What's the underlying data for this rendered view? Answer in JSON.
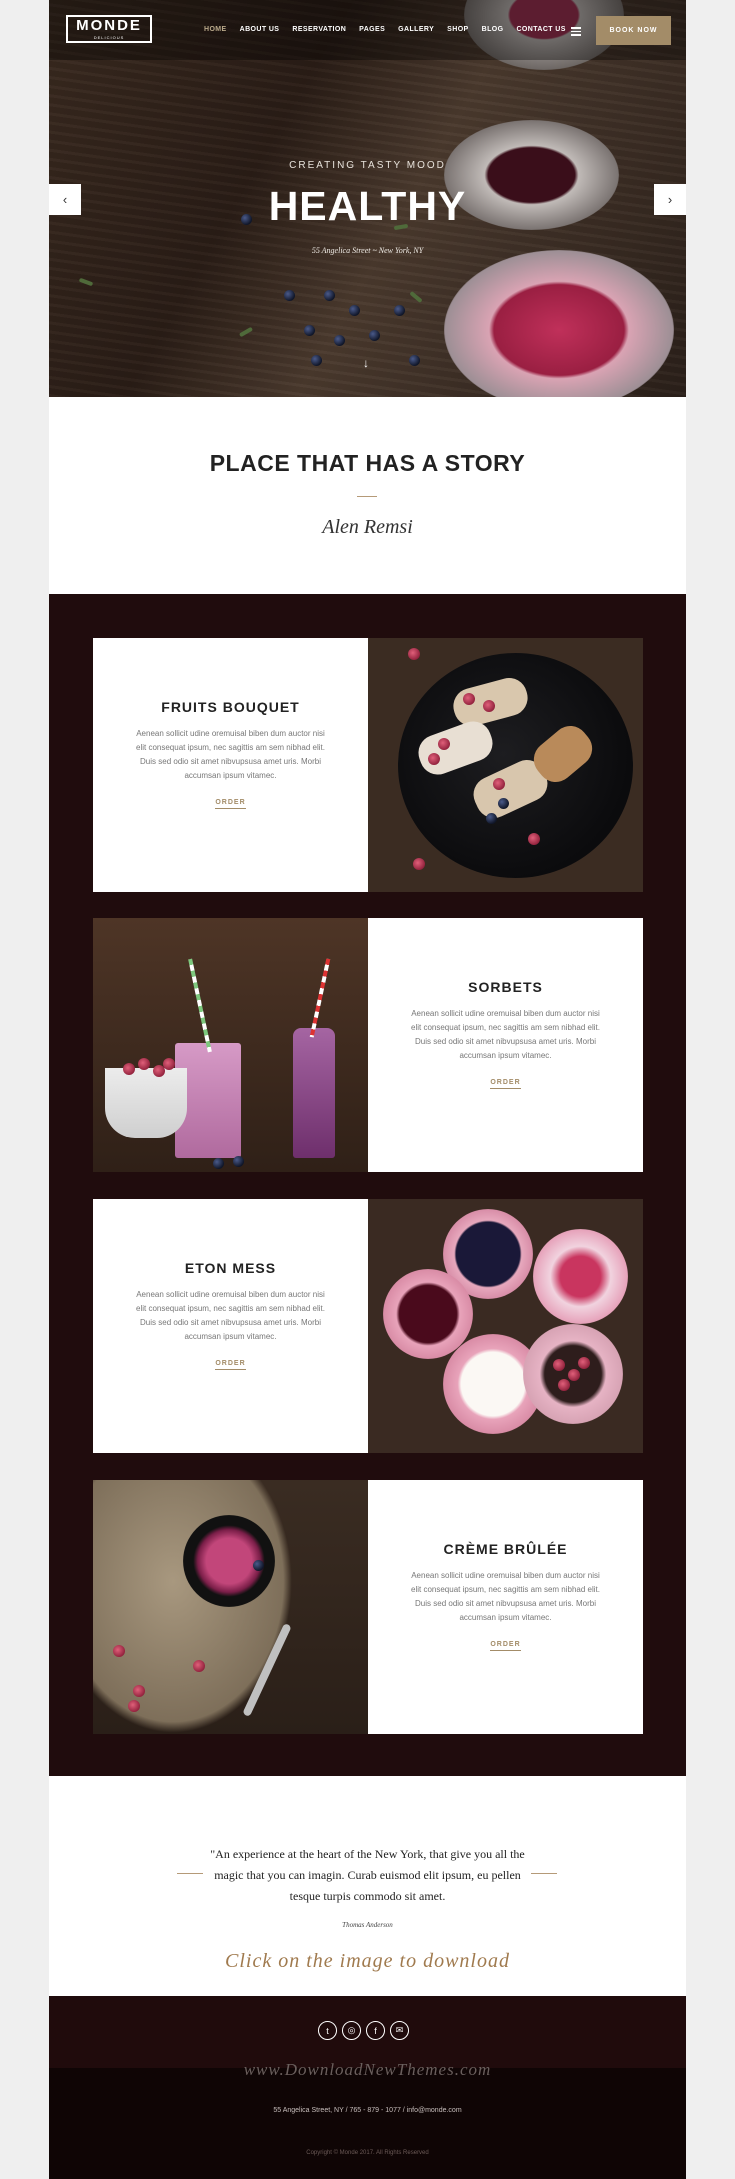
{
  "header": {
    "logo_name": "MONDE",
    "logo_sub": "DELICIOUS",
    "nav": [
      "HOME",
      "ABOUT US",
      "RESERVATION",
      "PAGES",
      "GALLERY",
      "SHOP",
      "BLOG",
      "CONTACT US"
    ],
    "book_now": "BOOK NOW",
    "menu_icon": "hamburger-icon"
  },
  "hero": {
    "eyebrow": "CREATING TASTY MOOD",
    "title": "HEALTHY",
    "address": "55 Angelica Street ~ New York, NY",
    "prev_icon": "‹",
    "next_icon": "›",
    "scroll_icon": "↓"
  },
  "story": {
    "title": "PLACE THAT HAS A STORY",
    "signature": "Alen Remsi"
  },
  "menu": [
    {
      "title": "FRUITS BOUQUET",
      "text": "Aenean sollicit udine oremuisal biben dum auctor nisi elit consequat ipsum, nec sagittis am sem nibhad elit. Duis sed odio sit amet nibvupsusa amet uris. Morbi accumsan ipsum vitamec.",
      "order": "ORDER"
    },
    {
      "title": "SORBETS",
      "text": "Aenean sollicit udine oremuisal biben dum auctor nisi elit consequat ipsum, nec sagittis am sem nibhad elit. Duis sed odio sit amet nibvupsusa amet uris. Morbi accumsan ipsum vitamec.",
      "order": "ORDER"
    },
    {
      "title": "ETON MESS",
      "text": "Aenean sollicit udine oremuisal biben dum auctor nisi elit consequat ipsum, nec sagittis am sem nibhad elit. Duis sed odio sit amet nibvupsusa amet uris. Morbi accumsan ipsum vitamec.",
      "order": "ORDER"
    },
    {
      "title": "CRÈME BRÛLÉE",
      "text": "Aenean sollicit udine oremuisal biben dum auctor nisi elit consequat ipsum, nec sagittis am sem nibhad elit. Duis sed odio sit amet nibvupsusa amet uris. Morbi accumsan ipsum vitamec.",
      "order": "ORDER"
    }
  ],
  "testimonial": {
    "quote": "\"An experience at the heart of the New York, that give you all the magic that you can imagin. Curab euismod elit ipsum, eu pellen tesque turpis commodo sit amet.",
    "author": "Thomas Anderson",
    "download_note": "Click on the image to download"
  },
  "footer": {
    "social_icons": [
      "twitter-icon",
      "instagram-icon",
      "facebook-icon",
      "mail-icon"
    ],
    "watermark": "www.DownloadNewThemes.com",
    "address": "55 Angelica Street, NY / 765 - 879 - 1077 / info@monde.com",
    "copyright": "Copyright © Monde 2017. All Rights Reserved"
  },
  "colors": {
    "accent": "#a38c68",
    "dark_section": "#200c0d",
    "page_bg": "#efefef"
  }
}
